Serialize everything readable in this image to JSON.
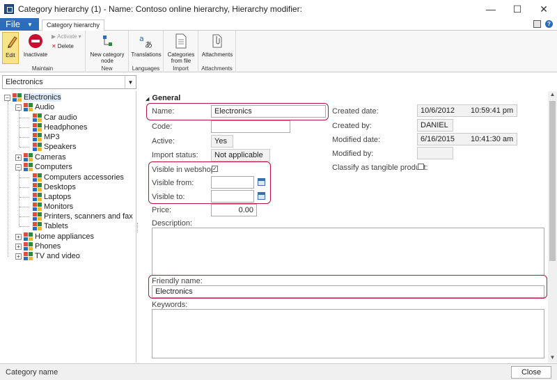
{
  "window": {
    "title": "Category hierarchy (1) - Name: Contoso online hierarchy, Hierarchy modifier:",
    "minimize_glyph": "—",
    "maximize_glyph": "☐",
    "close_glyph": "✕"
  },
  "ribbon": {
    "file_label": "File",
    "active_tab": "Category hierarchy",
    "groups": {
      "maintain": {
        "label": "Maintain",
        "edit": "Edit",
        "inactivate": "Inactivate",
        "activate": "Activate",
        "delete": "Delete"
      },
      "new": {
        "label": "New",
        "new_node": "New category node"
      },
      "languages": {
        "label": "Languages",
        "translations": "Translations"
      },
      "import": {
        "label": "Import",
        "categories_from_file": "Categories from file"
      },
      "attachments": {
        "label": "Attachments",
        "attachments": "Attachments"
      }
    }
  },
  "hierarchy_select": {
    "value": "Electronics"
  },
  "tree": {
    "root": "Electronics",
    "items": {
      "audio": "Audio",
      "car_audio": "Car audio",
      "headphones": "Headphones",
      "mp3": "MP3",
      "speakers": "Speakers",
      "cameras": "Cameras",
      "computers": "Computers",
      "computers_accessories": "Computers accessories",
      "desktops": "Desktops",
      "laptops": "Laptops",
      "monitors": "Monitors",
      "printers": "Printers, scanners and fax",
      "tablets": "Tablets",
      "home_appliances": "Home appliances",
      "phones": "Phones",
      "tv_video": "TV and video"
    }
  },
  "form": {
    "section": "General",
    "name_label": "Name:",
    "name_value": "Electronics",
    "code_label": "Code:",
    "code_value": "",
    "active_label": "Active:",
    "active_value": "Yes",
    "import_status_label": "Import status:",
    "import_status_value": "Not applicable",
    "visible_webshop_label": "Visible in webshop:",
    "visible_webshop_checked": true,
    "visible_from_label": "Visible from:",
    "visible_to_label": "Visible to:",
    "price_label": "Price:",
    "price_value": "0.00",
    "description_label": "Description:",
    "friendly_name_label": "Friendly name:",
    "friendly_name_value": "Electronics",
    "keywords_label": "Keywords:",
    "created_date_label": "Created date:",
    "created_date_value": "10/6/2012",
    "created_time_value": "10:59:41 pm",
    "created_by_label": "Created by:",
    "created_by_value": "DANIEL",
    "modified_date_label": "Modified date:",
    "modified_date_value": "6/16/2015",
    "modified_time_value": "10:41:30 am",
    "modified_by_label": "Modified by:",
    "modified_by_value": "",
    "tangible_label": "Classify as tangible product:",
    "tangible_checked": false
  },
  "status_bar": {
    "text": "Category name",
    "close_label": "Close"
  },
  "colors": {
    "accent": "#2a6ebb",
    "highlight": "#b5163a",
    "edit_bg": "#fbe38a"
  }
}
